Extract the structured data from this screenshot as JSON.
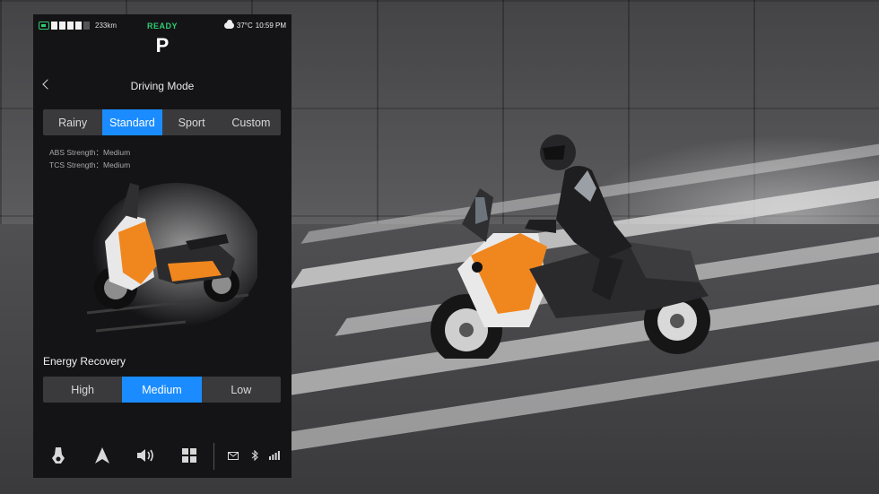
{
  "status_bar": {
    "range": "233km",
    "ready": "READY",
    "gear": "P",
    "temperature": "37°C",
    "time": "10:59 PM",
    "ready_color": "#2ecc71"
  },
  "header": {
    "title": "Driving Mode"
  },
  "driving_modes": {
    "options": [
      "Rainy",
      "Standard",
      "Sport",
      "Custom"
    ],
    "selected": "Standard"
  },
  "info": {
    "abs": "ABS Strength：Medium",
    "tcs": "TCS Strength：Medium"
  },
  "energy_recovery": {
    "title": "Energy Recovery",
    "options": [
      "High",
      "Medium",
      "Low"
    ],
    "selected": "Medium"
  },
  "dock": {
    "icons": [
      "scooter-icon",
      "navigation-icon",
      "volume-icon",
      "apps-grid-icon",
      "mail-icon",
      "bluetooth-icon",
      "signal-icon"
    ]
  },
  "theme": {
    "accent": "#1a8cff",
    "panel_bg": "#141416",
    "bike_accent": "#f0871e"
  }
}
